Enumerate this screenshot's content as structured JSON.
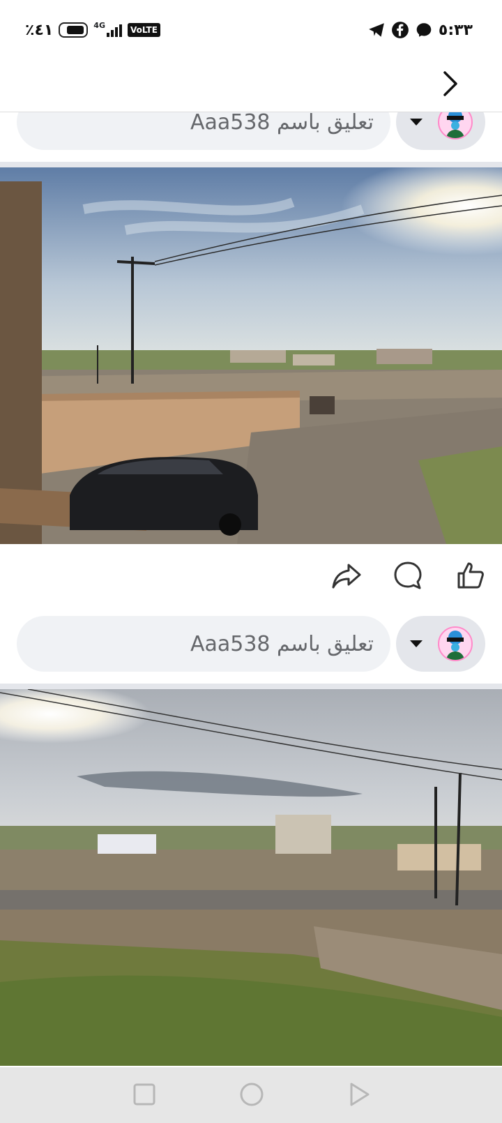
{
  "status_bar": {
    "battery_percent": "٪٤١",
    "network_type": "4G",
    "volte_label": "VoLTE",
    "clock": "٥:٣٣",
    "notification_icons": [
      "telegram-icon",
      "facebook-icon",
      "messenger-icon"
    ]
  },
  "nav": {
    "forward_icon": "chevron-right-icon"
  },
  "comment_composer_top": {
    "placeholder": "تعليق باسم Aaa538"
  },
  "post_actions": {
    "share_icon": "share-icon",
    "comment_icon": "comment-icon",
    "like_icon": "like-icon"
  },
  "comment_composer_bottom": {
    "placeholder": "تعليق باسم Aaa538"
  },
  "system_nav": {
    "recents_icon": "square-icon",
    "home_icon": "circle-icon",
    "back_icon": "triangle-icon"
  },
  "colors": {
    "input_bg": "#f0f2f5",
    "placeholder": "#65676b",
    "divider": "#e4e6eb"
  }
}
